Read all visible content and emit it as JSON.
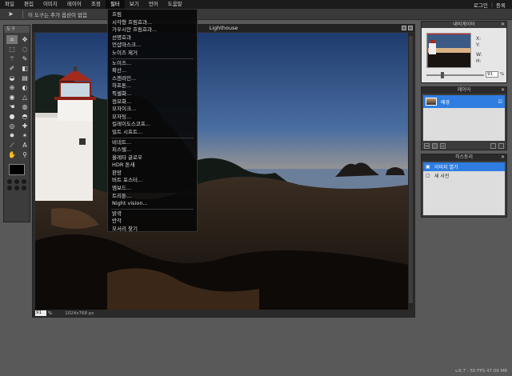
{
  "menubar": {
    "items": [
      {
        "label": "파일"
      },
      {
        "label": "편집"
      },
      {
        "label": "이미지"
      },
      {
        "label": "레이어"
      },
      {
        "label": "조정"
      },
      {
        "label": "필터"
      },
      {
        "label": "보기"
      },
      {
        "label": "언어"
      },
      {
        "label": "도움말"
      }
    ],
    "login": "로그인",
    "signup": "등록"
  },
  "optbar": {
    "message": "이 도구는 추가 옵션이 없음"
  },
  "tools": {
    "title": "도구"
  },
  "canvas": {
    "title": "Lighthouse",
    "zoom": "91",
    "zoom_unit": "%",
    "dimensions": "1024x768 px"
  },
  "filter_menu": {
    "groups": [
      [
        "흐림",
        "시각형 흐림효과...",
        "가우시안 흐림효과...",
        "선명효과",
        "언샵마스크...",
        "노이즈 제거"
      ],
      [
        "노이즈...",
        "확산...",
        "스캔라인...",
        "하프톤...",
        "픽셀화...",
        "점묘화...",
        "모자이크...",
        "모자팅...",
        "킬레이도스코프...",
        "빌트 시프트..."
      ],
      [
        "비네트...",
        "피스텔...",
        "올레타 글로우",
        "HDR 톤새",
        "판망",
        "버트 포스터...",
        "엠보드...",
        "트리툰...",
        "Night vision..."
      ],
      [
        "밝곽",
        "반각",
        "모서리 찾기"
      ]
    ]
  },
  "navigator": {
    "title": "내비게이터",
    "x_label": "X:",
    "y_label": "Y:",
    "w_label": "W:",
    "h_label": "H:",
    "zoom": "91",
    "zoom_unit": "%"
  },
  "layers": {
    "title": "레이어",
    "items": [
      {
        "name": "배경"
      }
    ]
  },
  "history": {
    "title": "히스토리",
    "items": [
      {
        "name": "이미지 열기",
        "selected": true
      },
      {
        "name": "새 사진",
        "selected": false
      }
    ]
  },
  "footer": {
    "fps": "v.6.7 - 55 FPS 47.09 MB"
  },
  "colors": {
    "accent": "#2f7de0",
    "primary_color": "#000000"
  }
}
